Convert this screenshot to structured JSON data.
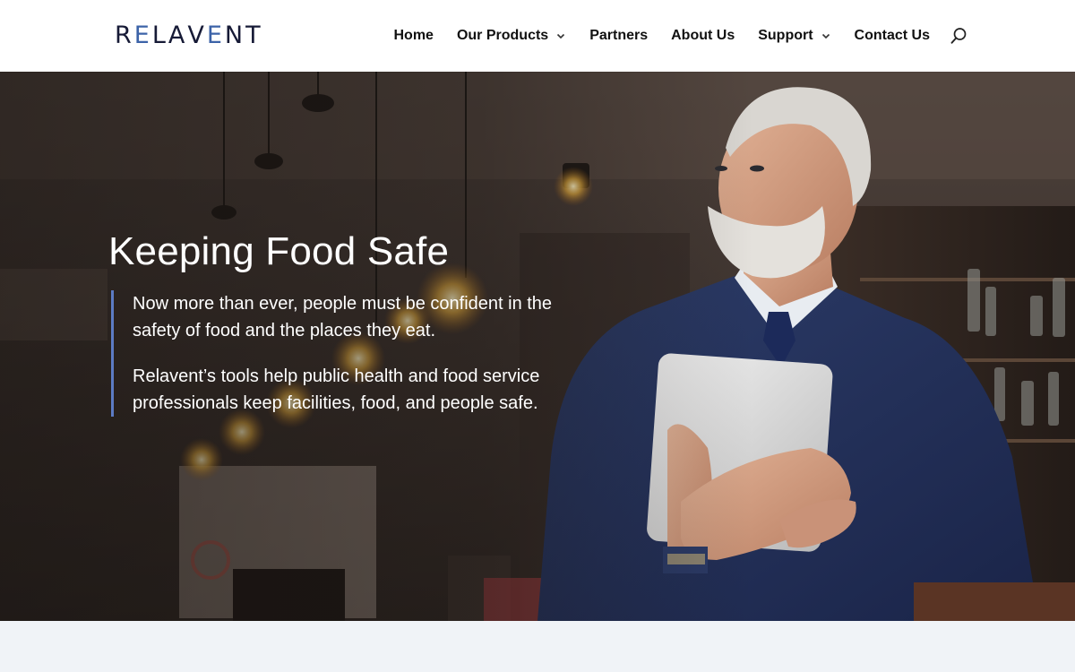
{
  "logo": {
    "letters": [
      "R",
      "E",
      "L",
      "A",
      "V",
      "E",
      "N",
      "T"
    ],
    "primary_color": "#161a36",
    "accent_color": "#3c63a8"
  },
  "nav": {
    "items": [
      {
        "label": "Home",
        "has_dropdown": false
      },
      {
        "label": "Our Products",
        "has_dropdown": true
      },
      {
        "label": "Partners",
        "has_dropdown": false
      },
      {
        "label": "About Us",
        "has_dropdown": false
      },
      {
        "label": "Support",
        "has_dropdown": true
      },
      {
        "label": "Contact Us",
        "has_dropdown": false
      }
    ],
    "search_icon": "search-icon"
  },
  "hero": {
    "title": "Keeping Food Safe",
    "paragraphs": [
      "Now more than ever, people must be confident in the safety of food and the places they eat.",
      "Relavent’s tools help public health and food service professionals keep facilities, food, and people safe."
    ],
    "quote_border_color": "#5c7bc4"
  }
}
